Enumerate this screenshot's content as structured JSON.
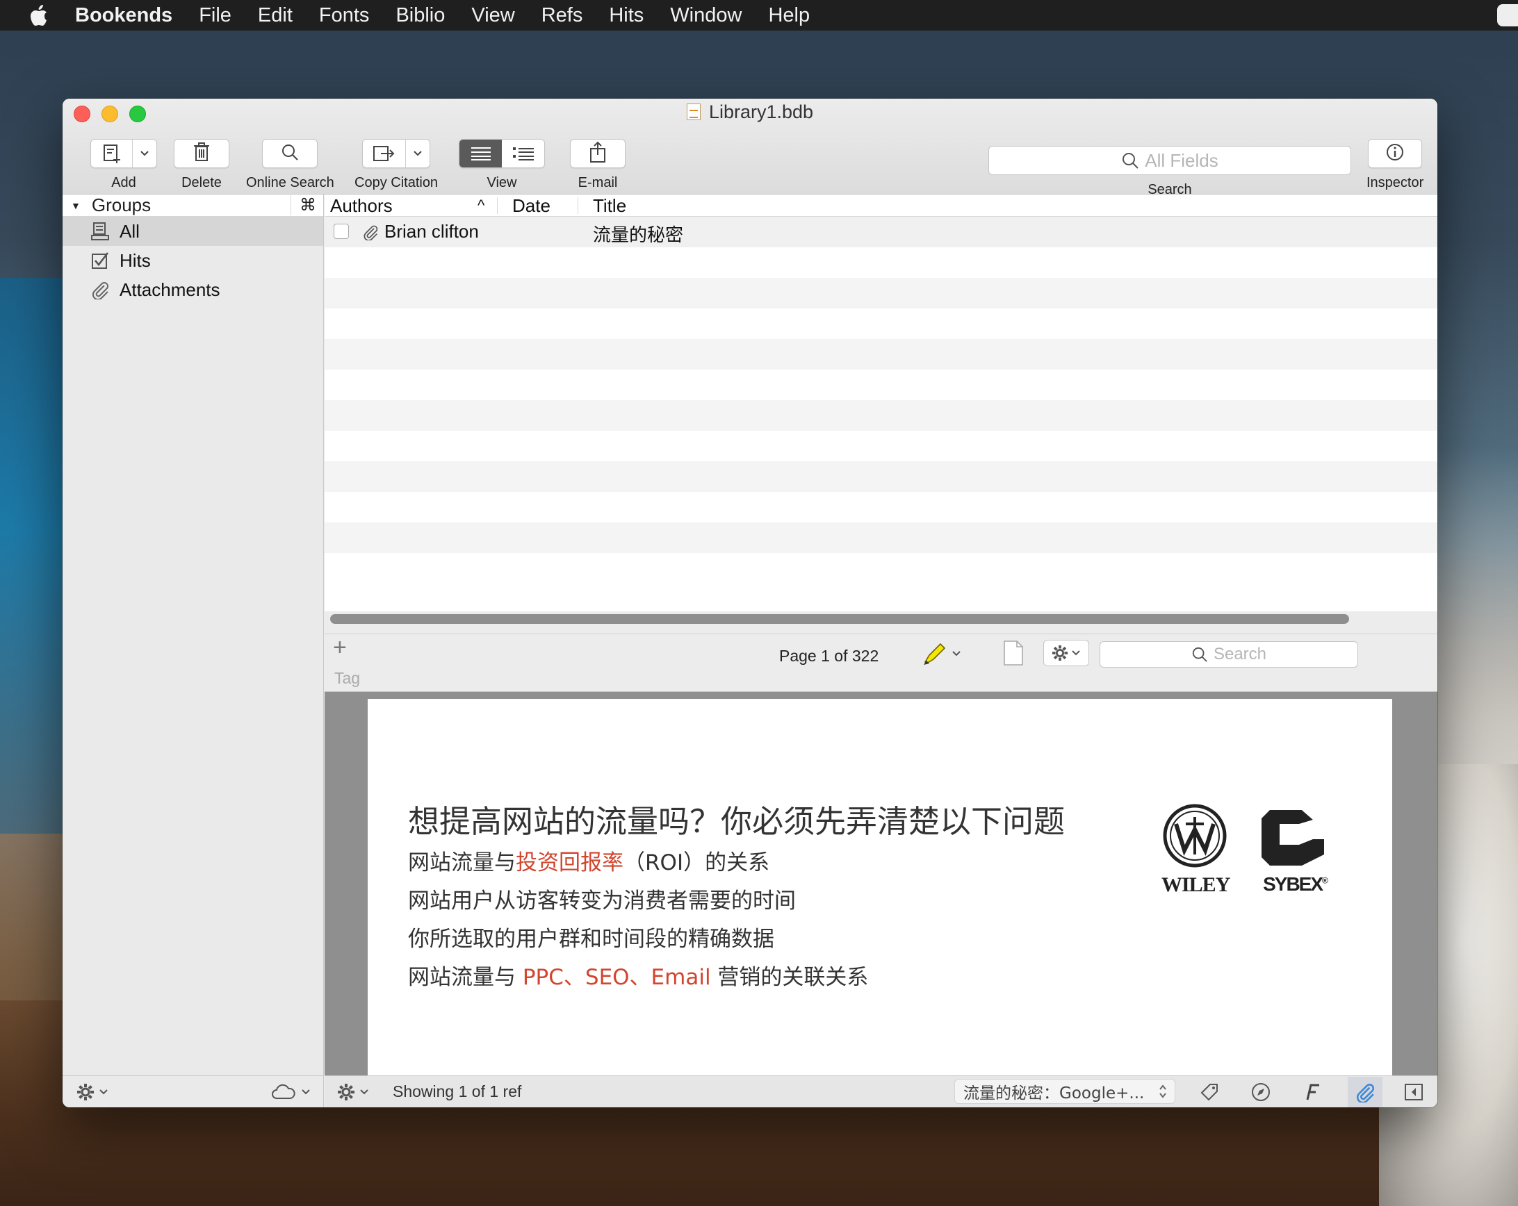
{
  "menubar": {
    "app": "Bookends",
    "items": [
      "File",
      "Edit",
      "Fonts",
      "Biblio",
      "View",
      "Refs",
      "Hits",
      "Window",
      "Help"
    ]
  },
  "window": {
    "title": "Library1.bdb"
  },
  "toolbar": {
    "add": "Add",
    "delete": "Delete",
    "online_search": "Online Search",
    "copy_citation": "Copy Citation",
    "view": "View",
    "email": "E-mail",
    "search_placeholder": "All Fields",
    "search_label": "Search",
    "inspector": "Inspector"
  },
  "sidebar": {
    "header": "Groups",
    "header_shortcut": "⌘",
    "items": [
      {
        "label": "All",
        "icon": "library-icon",
        "selected": true
      },
      {
        "label": "Hits",
        "icon": "checkbox-icon",
        "selected": false
      },
      {
        "label": "Attachments",
        "icon": "paperclip-icon",
        "selected": false
      }
    ]
  },
  "table": {
    "columns": [
      "Authors",
      "Date",
      "Title"
    ],
    "sort_indicator": "^",
    "rows": [
      {
        "author": "Brian clifton",
        "date": "",
        "title": "流量的秘密",
        "has_attachment": true,
        "checked": false
      }
    ]
  },
  "preview": {
    "page_indicator": "Page 1 of 322",
    "tag_label": "Tag",
    "add_symbol": "+",
    "search_placeholder": "Search",
    "highlight_color": "#f5e600"
  },
  "pdf": {
    "title": "想提高网站的流量吗？你必须先弄清楚以下问题",
    "line1_a": "网站流量与",
    "line1_red": "投资回报率",
    "line1_b": "（ROI）的关系",
    "line2": "网站用户从访客转变为消费者需要的时间",
    "line3": "你所选取的用户群和时间段的精确数据",
    "line4_a": "网站流量与 ",
    "line4_red": "PPC、SEO、Email",
    "line4_b": " 营销的关联关系",
    "logo_left": "WILEY",
    "logo_right": "SYBEX",
    "logo_right_mark": "®"
  },
  "statusbar": {
    "showing": "Showing 1 of 1 ref",
    "popup": "流量的秘密：Google+...",
    "accent": "#3d88d8"
  }
}
